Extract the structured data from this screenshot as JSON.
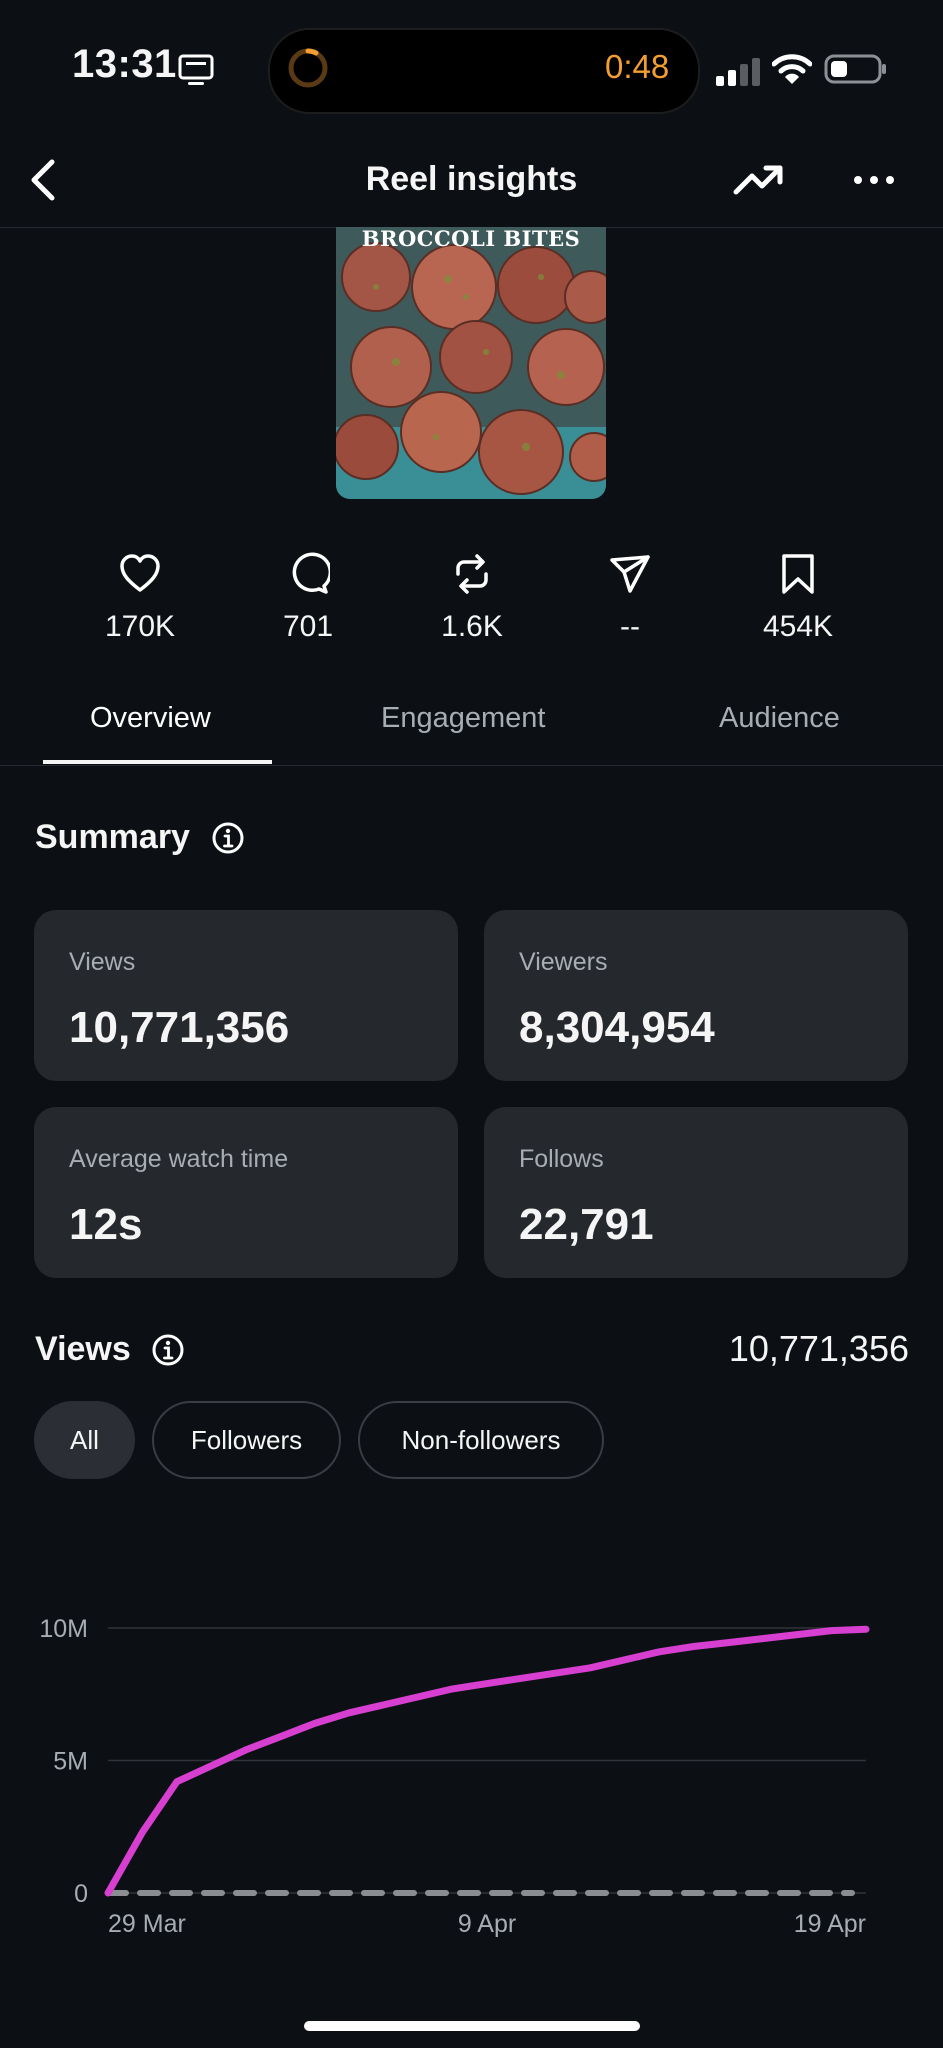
{
  "status_bar": {
    "time": "13:31",
    "timer": "0:48"
  },
  "nav": {
    "title": "Reel insights"
  },
  "thumbnail": {
    "caption": "BROCCOLI BITES"
  },
  "metrics": [
    {
      "icon": "heart-icon",
      "value": "170K"
    },
    {
      "icon": "comment-icon",
      "value": "701"
    },
    {
      "icon": "repost-icon",
      "value": "1.6K"
    },
    {
      "icon": "share-icon",
      "value": "--"
    },
    {
      "icon": "save-icon",
      "value": "454K"
    }
  ],
  "tabs": [
    {
      "label": "Overview",
      "active": true
    },
    {
      "label": "Engagement",
      "active": false
    },
    {
      "label": "Audience",
      "active": false
    }
  ],
  "summary": {
    "title": "Summary",
    "cards": [
      {
        "label": "Views",
        "value": "10,771,356"
      },
      {
        "label": "Viewers",
        "value": "8,304,954"
      },
      {
        "label": "Average watch time",
        "value": "12s"
      },
      {
        "label": "Follows",
        "value": "22,791"
      }
    ]
  },
  "views": {
    "title": "Views",
    "total": "10,771,356",
    "filters": [
      "All",
      "Followers",
      "Non-followers"
    ],
    "active_filter": "All"
  },
  "colors": {
    "accent": "#d63fd0",
    "background": "#0c1014",
    "card": "#25282d",
    "timer": "#f29e33"
  },
  "chart_data": {
    "type": "line",
    "x_ticks": [
      "29 Mar",
      "9 Apr",
      "19 Apr"
    ],
    "y_ticks": [
      "0",
      "5M",
      "10M"
    ],
    "ylim": [
      0,
      10000000
    ],
    "series": [
      {
        "color": "#d63fd0",
        "style": "solid",
        "x": [
          "29 Mar",
          "30 Mar",
          "31 Mar",
          "1 Apr",
          "2 Apr",
          "3 Apr",
          "4 Apr",
          "5 Apr",
          "6 Apr",
          "7 Apr",
          "8 Apr",
          "9 Apr",
          "10 Apr",
          "11 Apr",
          "12 Apr",
          "13 Apr",
          "14 Apr",
          "15 Apr",
          "16 Apr",
          "17 Apr",
          "18 Apr",
          "19 Apr",
          "20 Apr"
        ],
        "values": [
          0,
          2300000,
          4200000,
          4800000,
          5400000,
          5900000,
          6400000,
          6800000,
          7100000,
          7400000,
          7700000,
          7900000,
          8100000,
          8300000,
          8500000,
          8800000,
          9100000,
          9300000,
          9450000,
          9600000,
          9750000,
          9900000,
          9950000
        ]
      },
      {
        "color": "#8a8d92",
        "style": "dashed",
        "x": [
          "29 Mar",
          "20 Apr"
        ],
        "values": [
          0,
          0
        ]
      }
    ]
  }
}
